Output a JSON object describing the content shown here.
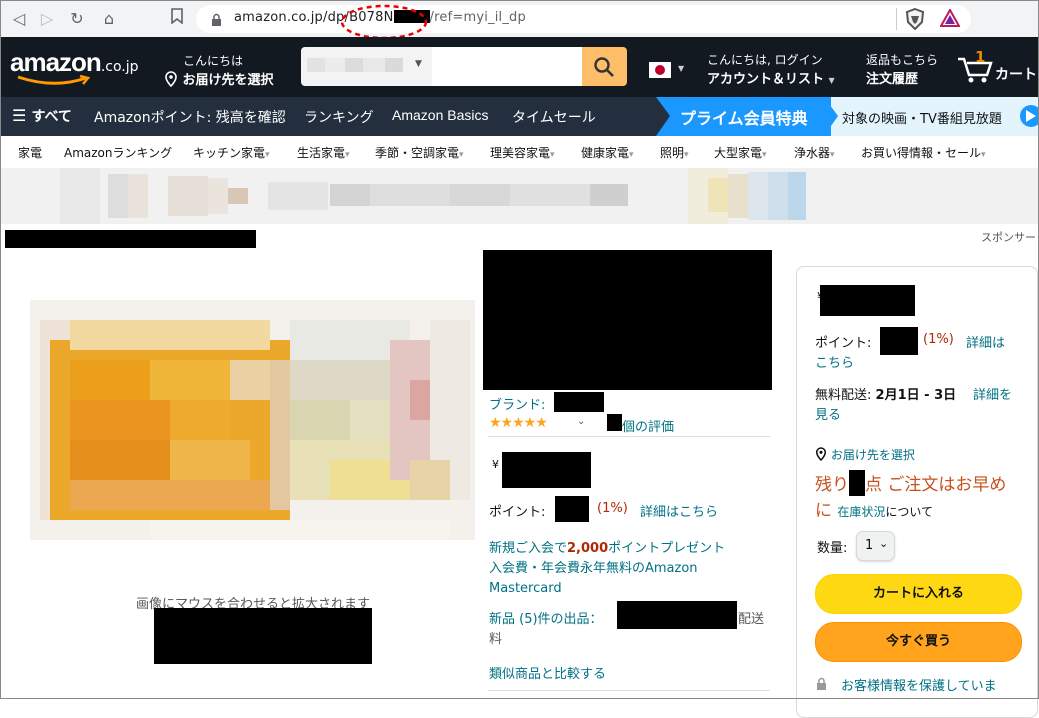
{
  "browser": {
    "url_host": "amazon.co.jp/dp/",
    "url_asin_prefix": "B078N",
    "url_suffix": "/ref=myi_il_dp"
  },
  "header": {
    "logo_text": "amazon",
    "logo_suffix": ".co.jp",
    "deliver_line1": "こんにちは",
    "deliver_line2": "お届け先を選択",
    "account_line1": "こんにちは, ログイン",
    "account_line2": "アカウント＆リスト",
    "orders_line1": "返品もこちら",
    "orders_line2": "注文履歴",
    "cart_count": "1",
    "cart_label": "カート"
  },
  "main_nav": {
    "all_label": "すべて",
    "items": [
      "Amazonポイント: 残高を確認",
      "ランキング",
      "Amazon Basics",
      "タイムセール"
    ],
    "prime_banner": "プライム会員特典",
    "prime_promo": "対象の映画・TV番組見放題"
  },
  "sub_nav": {
    "items": [
      "家電",
      "Amazonランキング",
      "キッチン家電",
      "生活家電",
      "季節・空調家電",
      "理美容家電",
      "健康家電",
      "照明",
      "大型家電",
      "浄水器",
      "お買い得情報・セール"
    ]
  },
  "sponsor_label": "スポンサー",
  "image_area": {
    "zoom_hint": "画像にマウスを合わせると拡大されます"
  },
  "product": {
    "brand_label": "ブランド:",
    "rating_suffix": "個の評価",
    "currency": "¥",
    "points_label": "ポイント:",
    "points_pct": "(1%)",
    "points_link": "詳細はこちら",
    "promo_line1_a": "新規ご入会で",
    "promo_line1_b": "2,000",
    "promo_line1_c": "ポイントプレゼント",
    "promo_line2": "入会費・年会費永年無料のAmazon",
    "promo_line3": "Mastercard",
    "new_offers": "新品 (5)件の出品：",
    "shipping_suffix": "配送",
    "shipping_suffix2": "料",
    "compare_link": "類似商品と比較する"
  },
  "buybox": {
    "currency": "¥",
    "points_label": "ポイント:",
    "points_pct": "(1%)",
    "points_link1": "詳細は",
    "points_link2": "こちら",
    "shipping_label": "無料配送:",
    "shipping_date": "2月1日 - 3日",
    "shipping_link1": "詳細を",
    "shipping_link2": "見る",
    "deliver_to": "お届け先を選択",
    "stock_a": "残り",
    "stock_b": "点 ご注文はお早め",
    "stock_c": "に",
    "stock_link": "在庫状況",
    "stock_about": "について",
    "qty_label": "数量:",
    "qty_value": "1",
    "add_to_cart": "カートに入れる",
    "buy_now": "今すぐ買う",
    "secure": "お客様情報を保護していま"
  }
}
